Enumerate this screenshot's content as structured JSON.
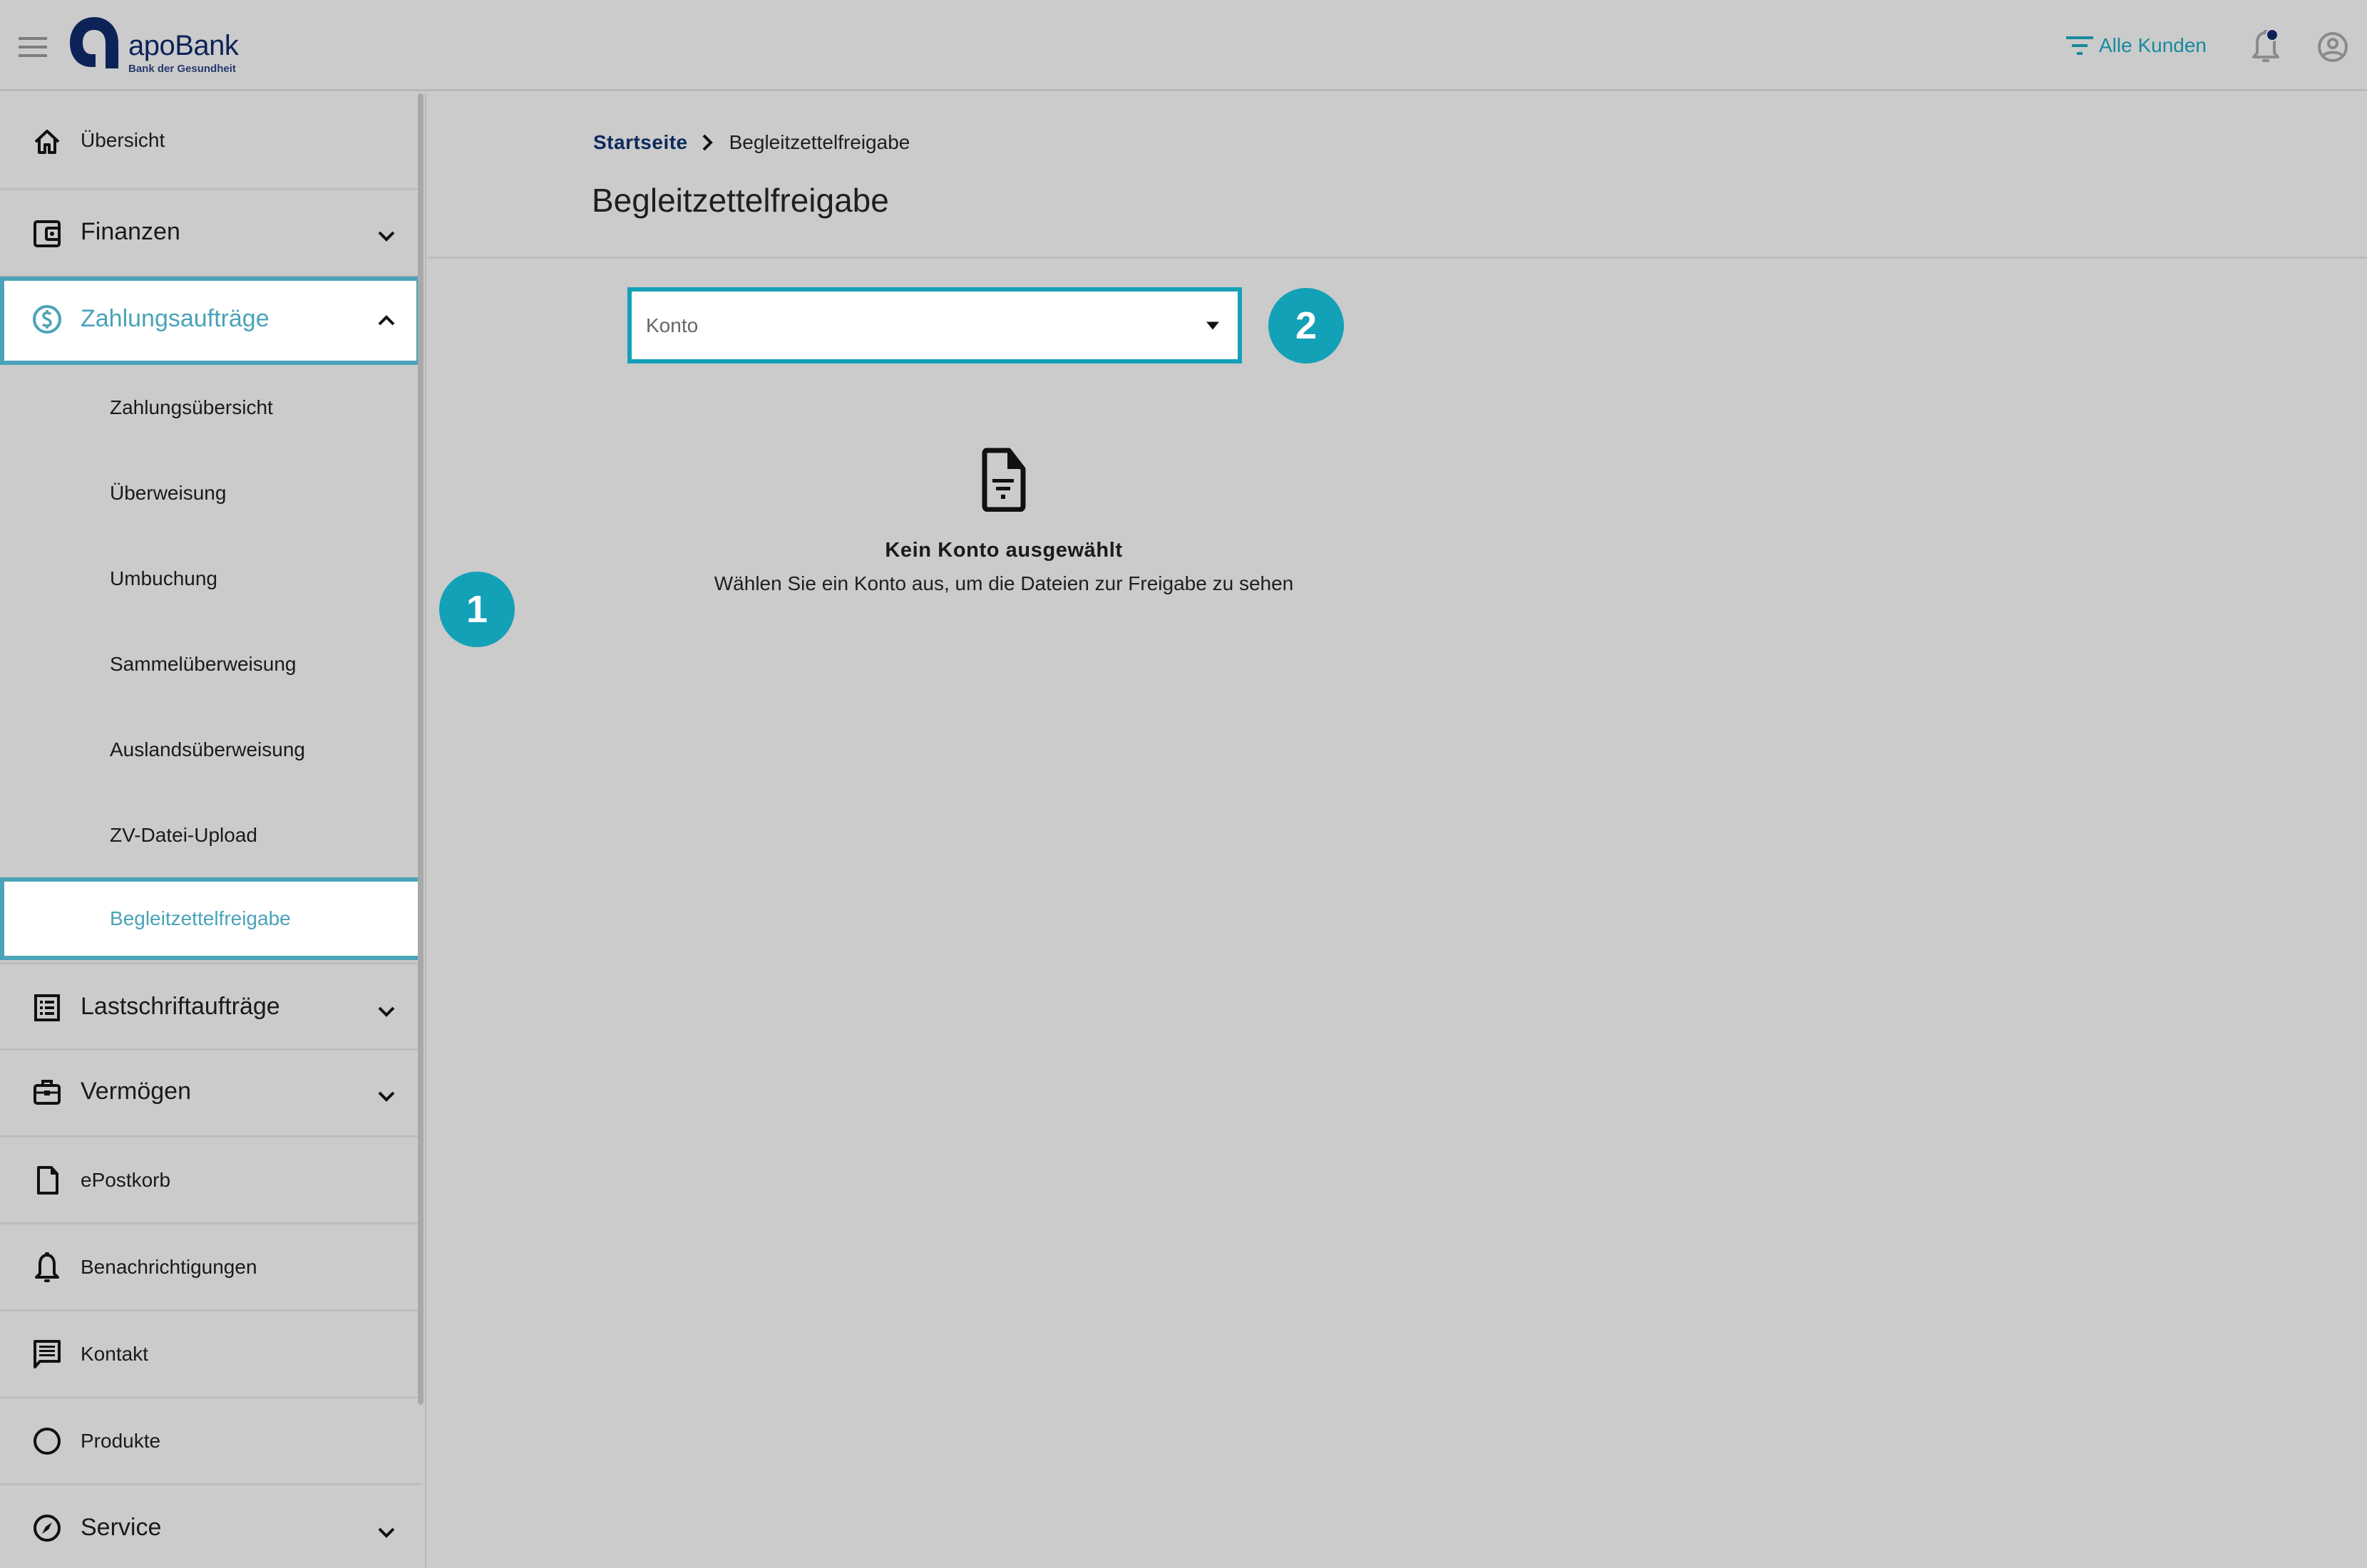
{
  "header": {
    "menu_icon": "hamburger-menu-icon",
    "logo": {
      "name": "apoBank",
      "tagline": "Bank der Gesundheit"
    },
    "customer_filter": {
      "icon": "filter-icon",
      "label": "Alle Kunden"
    },
    "notifications": {
      "icon": "bell-icon",
      "has_unread": true
    },
    "account": {
      "icon": "account-circle-icon"
    }
  },
  "sidebar": {
    "items": [
      {
        "label": "Übersicht",
        "icon": "home-icon",
        "expandable": false
      },
      {
        "label": "Finanzen",
        "icon": "wallet-icon",
        "expandable": true,
        "expanded": false
      },
      {
        "label": "Zahlungsaufträge",
        "icon": "dollar-circle-icon",
        "expandable": true,
        "expanded": true,
        "active": true,
        "children": [
          {
            "label": "Zahlungsübersicht"
          },
          {
            "label": "Überweisung"
          },
          {
            "label": "Umbuchung"
          },
          {
            "label": "Sammelüberweisung"
          },
          {
            "label": "Auslandsüberweisung"
          },
          {
            "label": "ZV-Datei-Upload"
          },
          {
            "label": "Begleitzettelfreigabe",
            "active": true
          }
        ]
      },
      {
        "label": "Lastschriftaufträge",
        "icon": "list-icon",
        "expandable": true,
        "expanded": false
      },
      {
        "label": "Vermögen",
        "icon": "briefcase-icon",
        "expandable": true,
        "expanded": false
      },
      {
        "label": "ePostkorb",
        "icon": "document-icon",
        "expandable": false
      },
      {
        "label": "Benachrichtigungen",
        "icon": "bell-icon",
        "expandable": false
      },
      {
        "label": "Kontakt",
        "icon": "chat-icon",
        "expandable": false
      },
      {
        "label": "Produkte",
        "icon": "circle-icon",
        "expandable": false
      },
      {
        "label": "Service",
        "icon": "compass-icon",
        "expandable": true,
        "expanded": false
      }
    ]
  },
  "breadcrumb": {
    "home": "Startseite",
    "current": "Begleitzettelfreigabe"
  },
  "page": {
    "title": "Begleitzettelfreigabe",
    "account_select": {
      "placeholder": "Konto",
      "value": ""
    },
    "empty_state": {
      "icon": "document-filter-icon",
      "title": "Kein Konto ausgewählt",
      "subtitle": "Wählen Sie ein Konto aus, um die Dateien zur Freigabe zu sehen"
    }
  },
  "annotations": [
    {
      "label": "1"
    },
    {
      "label": "2"
    }
  ],
  "colors": {
    "accent_teal": "#13a1b8",
    "active_nav": "#4aa3b8",
    "brand_navy": "#0d2257",
    "filter_text": "#178a9e",
    "overlay_bg": "#cbcbcb"
  }
}
